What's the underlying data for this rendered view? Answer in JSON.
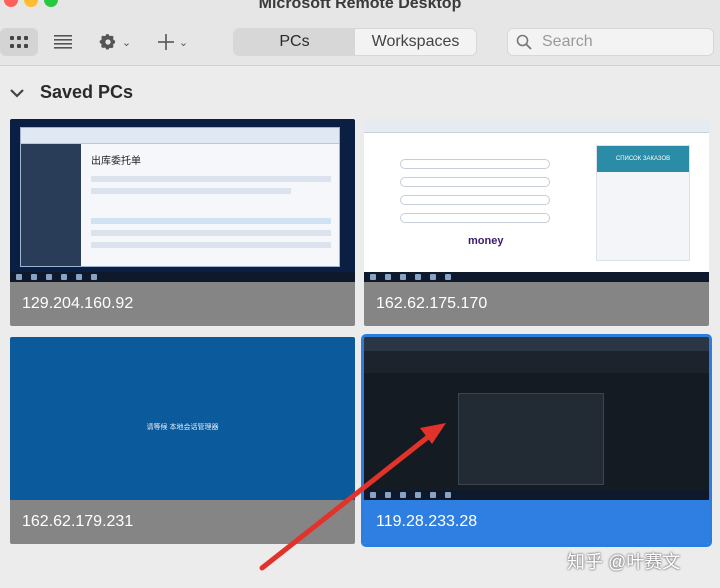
{
  "window": {
    "title": "Microsoft Remote Desktop"
  },
  "toolbar": {
    "segments": [
      "PCs",
      "Workspaces"
    ],
    "active_segment": "PCs",
    "search_placeholder": "Search"
  },
  "section": {
    "title": "Saved PCs"
  },
  "pcs": [
    {
      "label": "129.204.160.92",
      "preview_heading": "出库委托单",
      "selected": false
    },
    {
      "label": "162.62.175.170",
      "preview_heading": "СПИСОК ЗАКАЗОВ",
      "preview_text": "money",
      "selected": false
    },
    {
      "label": "162.62.179.231",
      "preview_message": "请等候 本地会话管理器",
      "selected": false
    },
    {
      "label": "119.28.233.28",
      "selected": true
    }
  ],
  "watermark": "知乎 @叶赛文",
  "colors": {
    "accent": "#2f7fe2",
    "arrow": "#e2332b",
    "caption_bg": "#858585"
  },
  "icons": [
    "grid-view-icon",
    "list-view-icon",
    "gear-icon",
    "plus-icon",
    "search-icon",
    "chevron-down-icon"
  ]
}
